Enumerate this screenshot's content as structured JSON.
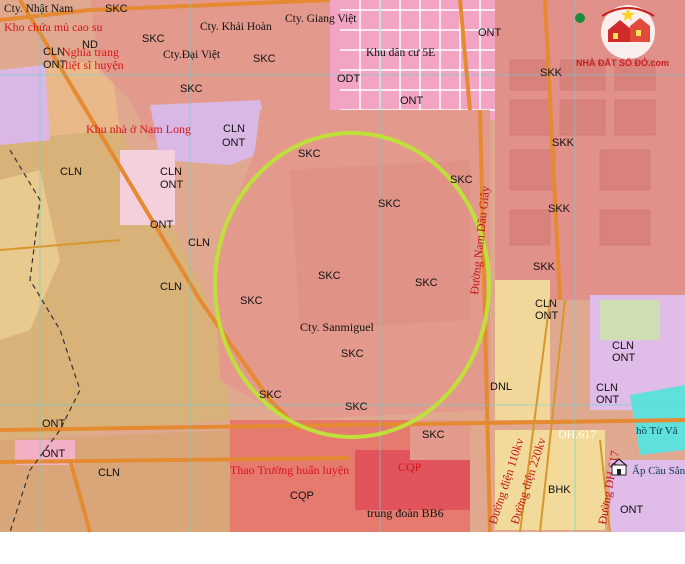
{
  "map": {
    "land_use_codes": {
      "skc": "SKC",
      "skk": "SKK",
      "cln": "CLN",
      "ont": "ONT",
      "odt": "ODT",
      "dnl": "DNL",
      "cqp": "CQP",
      "bhk": "BHK",
      "nd": "ND"
    },
    "place_labels": {
      "cty_nhat_nam": "Cty. Nhật Nam",
      "khu_chua_mu": "Kho chứa mủ cao su",
      "cty_khai_hoan": "Cty. Khải Hoàn",
      "cty_giang_viet": "Cty. Giang Việt",
      "nghia_trang": "Nghĩa trang",
      "liet_si": "liệt sĩ huyện",
      "cty_dai_viet": "Cty.Đại Việt",
      "khu_dan_cu": "Khu dân cư 5E",
      "khu_nha_o": "Khu nhà ở Nam Long",
      "cty_sanmiguel": "Cty. Sanmiguel",
      "thao_truong": "Thao Trường huấn luyện",
      "trung_doan": "trung đoàn BB6",
      "ho_tu": "hồ Từ Vă",
      "ap_cau_sang": "Ấp Cầu Sắn"
    },
    "road_labels": {
      "duong_nam_dau_giay": "Đường Nam Dầu Giây",
      "duong_dien_110": "Đường điện 110kv",
      "duong_dien_220": "Đường điện 220kv",
      "dh617": "DH.617",
      "dh617_b": "Đường DH.617"
    },
    "watermark": "NHÀ ĐẤT SỔ ĐỎ.com",
    "colors": {
      "industrial": "#e89a90",
      "industrial_dark": "#e0847c",
      "residential": "#f2a4c2",
      "perennial": "#e8c98e",
      "agri": "#f3e29a",
      "military": "#e2545c",
      "highlight_circle": "#bfe03a",
      "road": "#e58a30",
      "purple": "#d9b8e6",
      "cyan": "#5fe0da"
    }
  }
}
